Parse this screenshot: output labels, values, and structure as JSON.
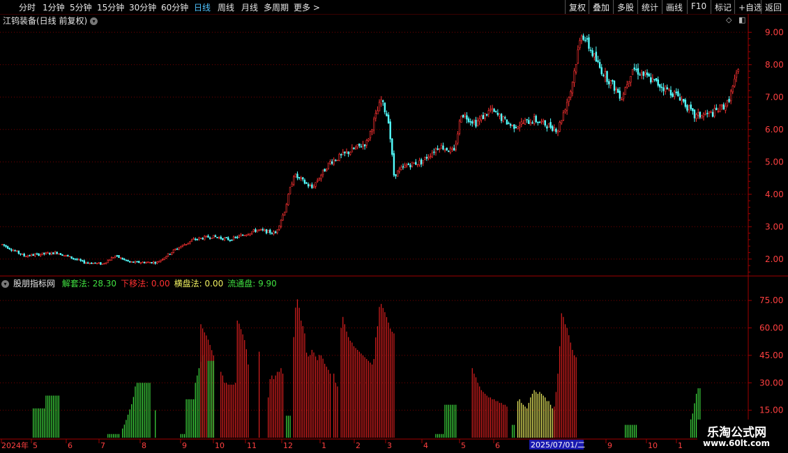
{
  "toolbar": {
    "left_items": [
      "分时",
      "1分钟",
      "5分钟",
      "15分钟",
      "30分钟",
      "60分钟",
      "日线",
      "周线",
      "月线",
      "多周期",
      "更多 >"
    ],
    "active_index": 6,
    "right_items": [
      "复权",
      "叠加",
      "多股",
      "统计",
      "画线",
      "F10",
      "标记",
      "+自选",
      "返回"
    ]
  },
  "kline": {
    "title": "江钨装备(日线 前复权)",
    "price_axis": [
      "9.00",
      "8.00",
      "7.00",
      "6.00",
      "5.00",
      "4.00",
      "3.00",
      "2.00"
    ],
    "price_min": 1.5,
    "price_max": 9.2
  },
  "indicator": {
    "name": "股朋指标网",
    "fields": [
      {
        "label": "解套法:",
        "value": "28.30",
        "color": "#40e040"
      },
      {
        "label": "下移法:",
        "value": "0.00",
        "color": "#ff3030"
      },
      {
        "label": "横盘法:",
        "value": "0.00",
        "color": "#f0f060"
      },
      {
        "label": "流通盘:",
        "value": "9.90",
        "color": "#40e040"
      }
    ],
    "axis": [
      "75.00",
      "60.00",
      "45.00",
      "30.00",
      "15.00"
    ]
  },
  "date_axis": {
    "labels": [
      "2024年",
      "5",
      "6",
      "7",
      "8",
      "9",
      "10",
      "11",
      "12",
      "1",
      "2",
      "3",
      "4",
      "5",
      "6",
      "9",
      "10",
      "1"
    ],
    "selected": "2025/07/01/二"
  },
  "watermark": {
    "line1": "乐淘公式网",
    "line2": "www.60lt.com"
  },
  "colors": {
    "up": "#ff3232",
    "down": "#54ffff",
    "green": "#40e040",
    "yellow": "#f0f060",
    "grid": "#7a0000"
  },
  "chart_data": {
    "type": "candlestick+bar",
    "price_keypoints": [
      [
        0,
        2.45
      ],
      [
        12,
        2.1
      ],
      [
        30,
        2.2
      ],
      [
        45,
        1.9
      ],
      [
        55,
        1.85
      ],
      [
        62,
        2.1
      ],
      [
        70,
        1.9
      ],
      [
        85,
        1.9
      ],
      [
        95,
        2.3
      ],
      [
        105,
        2.6
      ],
      [
        115,
        2.7
      ],
      [
        125,
        2.6
      ],
      [
        140,
        2.9
      ],
      [
        150,
        2.8
      ],
      [
        155,
        3.5
      ],
      [
        160,
        4.6
      ],
      [
        170,
        4.2
      ],
      [
        180,
        5.0
      ],
      [
        190,
        5.3
      ],
      [
        200,
        5.6
      ],
      [
        208,
        6.9
      ],
      [
        212,
        6.3
      ],
      [
        215,
        4.6
      ],
      [
        222,
        4.9
      ],
      [
        230,
        5.0
      ],
      [
        240,
        5.5
      ],
      [
        248,
        5.3
      ],
      [
        252,
        6.5
      ],
      [
        260,
        6.2
      ],
      [
        268,
        6.6
      ],
      [
        280,
        6.1
      ],
      [
        292,
        6.3
      ],
      [
        305,
        6.0
      ],
      [
        312,
        7.2
      ],
      [
        318,
        9.0
      ],
      [
        328,
        7.9
      ],
      [
        340,
        7.0
      ],
      [
        346,
        7.9
      ],
      [
        360,
        7.4
      ],
      [
        372,
        7.0
      ],
      [
        380,
        6.4
      ],
      [
        390,
        6.5
      ],
      [
        398,
        6.8
      ],
      [
        404,
        7.8
      ]
    ],
    "indicator_bars": [
      {
        "color": "green",
        "start": 17,
        "end": 23,
        "value": 16
      },
      {
        "color": "green",
        "start": 24,
        "end": 31,
        "value": 23
      },
      {
        "color": "green",
        "start": 58,
        "end": 64,
        "value": 2
      },
      {
        "color": "green",
        "start": 66,
        "end": 73,
        "value": [
          5,
          8,
          12,
          16,
          20,
          28
        ]
      },
      {
        "color": "green",
        "start": 74,
        "end": 81,
        "value": 30
      },
      {
        "color": "green",
        "start": 84,
        "end": 84,
        "value": 15
      },
      {
        "color": "green",
        "start": 98,
        "end": 100,
        "value": 2
      },
      {
        "color": "green",
        "start": 101,
        "end": 106,
        "value": 21
      },
      {
        "color": "green",
        "start": 106,
        "end": 110,
        "value": [
          30,
          38,
          45
        ]
      },
      {
        "color": "red",
        "start": 109,
        "end": 116,
        "value": [
          62,
          58,
          55,
          50,
          45
        ]
      },
      {
        "color": "green",
        "start": 113,
        "end": 116,
        "value": 42
      },
      {
        "color": "red",
        "start": 120,
        "end": 128,
        "value": [
          36,
          34,
          30,
          30,
          29,
          29,
          29,
          29,
          30
        ]
      },
      {
        "color": "red",
        "start": 129,
        "end": 135,
        "value": [
          64,
          62,
          58,
          55,
          50,
          40
        ]
      },
      {
        "color": "red",
        "start": 141,
        "end": 141,
        "value": 47
      },
      {
        "color": "red",
        "start": 146,
        "end": 154,
        "value": [
          22,
          32,
          34,
          32,
          34,
          36,
          36,
          38,
          35
        ]
      },
      {
        "color": "green",
        "start": 156,
        "end": 158,
        "value": 12
      },
      {
        "color": "red",
        "start": 160,
        "end": 180,
        "value": [
          55,
          78,
          72,
          62,
          60,
          45,
          44,
          48,
          46,
          42,
          46,
          44,
          40,
          38,
          35
        ]
      },
      {
        "color": "red",
        "start": 182,
        "end": 184,
        "value": [
          35,
          30,
          28
        ]
      },
      {
        "color": "red",
        "start": 186,
        "end": 203,
        "value": [
          60,
          66,
          62,
          58,
          55,
          53,
          52,
          50,
          49,
          48,
          47,
          46,
          45,
          44,
          43,
          42,
          41,
          40
        ]
      },
      {
        "color": "red",
        "start": 204,
        "end": 215,
        "value": [
          43,
          56,
          62,
          75,
          72,
          70,
          67,
          64,
          60,
          58,
          57
        ]
      },
      {
        "color": "green",
        "start": 238,
        "end": 242,
        "value": 2
      },
      {
        "color": "green",
        "start": 243,
        "end": 249,
        "value": 18
      },
      {
        "color": "red",
        "start": 258,
        "end": 277,
        "value": [
          38,
          35,
          33,
          30,
          28,
          26,
          25,
          24,
          23,
          22,
          22,
          21,
          21,
          20,
          20,
          19,
          19,
          18,
          18,
          17
        ]
      },
      {
        "color": "green",
        "start": 280,
        "end": 281,
        "value": 7
      },
      {
        "color": "yellow",
        "start": 283,
        "end": 303,
        "value": [
          20,
          21,
          19,
          18,
          17,
          16,
          19,
          22,
          24,
          26,
          25,
          24,
          25,
          24,
          23,
          22,
          20,
          20,
          18,
          16,
          15
        ]
      },
      {
        "color": "red",
        "start": 303,
        "end": 315,
        "value": [
          17,
          25,
          35,
          50,
          68,
          66,
          62,
          60,
          56,
          52,
          48,
          45,
          44
        ]
      },
      {
        "color": "green",
        "start": 342,
        "end": 348,
        "value": 7
      },
      {
        "color": "green",
        "start": 378,
        "end": 383,
        "value": [
          10,
          14,
          22,
          27,
          27
        ]
      }
    ]
  }
}
